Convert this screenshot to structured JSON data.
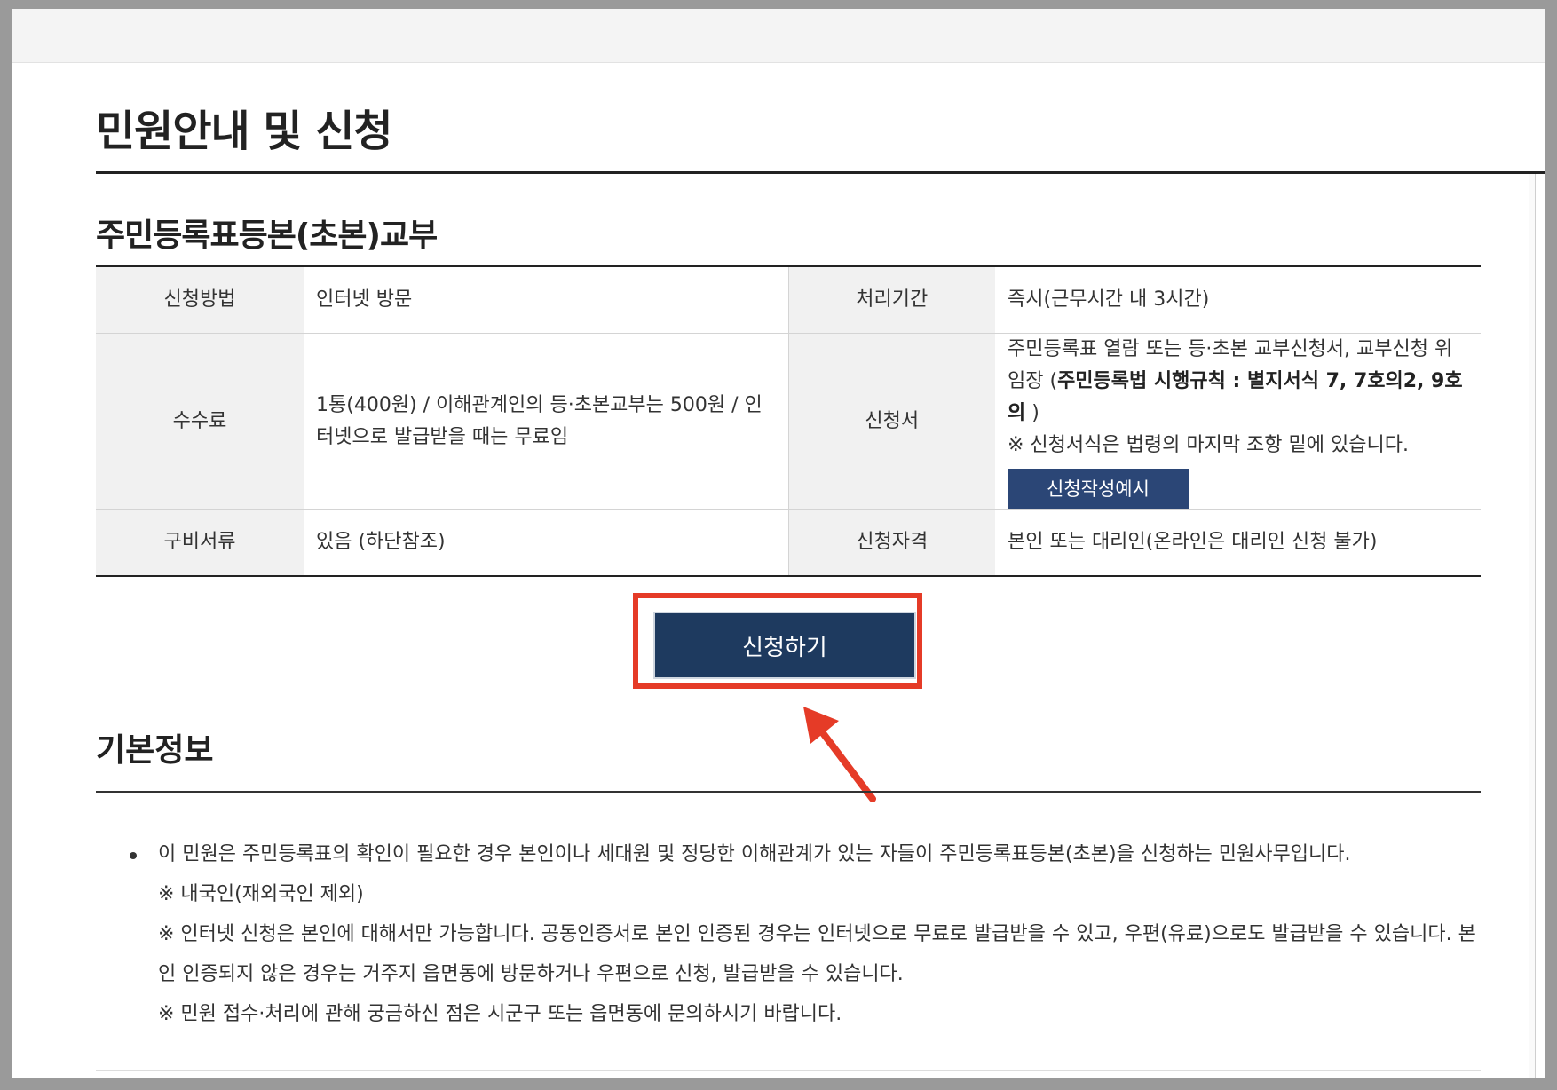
{
  "page": {
    "title": "민원안내 및 신청",
    "section_title": "주민등록표등본(초본)교부"
  },
  "info_table": {
    "method_label": "신청방법",
    "method_value": "인터넷 방문",
    "period_label": "처리기간",
    "period_value": "즉시(근무시간 내 3시간)",
    "fee_label": "수수료",
    "fee_value": "1통(400원) / 이해관계인의 등·초본교부는 500원 / 인터넷으로 발급받을 때는 무료임",
    "form_label": "신청서",
    "form_value_a": "주민등록표 열람 또는 등·초본 교부신청서, 교부신청 위임장 (",
    "form_value_bold": "주민등록법 시행규칙 : 별지서식 7, 7호의2, 9호의",
    "form_value_c": " )",
    "form_note": "※ 신청서식은 법령의 마지막 조항 밑에 있습니다.",
    "form_example_button": "신청작성예시",
    "docs_label": "구비서류",
    "docs_value": "있음 (하단참조)",
    "qualification_label": "신청자격",
    "qualification_value": "본인 또는 대리인(온라인은 대리인 신청 불가)"
  },
  "apply_button": "신청하기",
  "basic_info": {
    "title": "기본정보",
    "main_text": "이 민원은 주민등록표의 확인이 필요한 경우 본인이나 세대원 및 정당한 이해관계가 있는 자들이 주민등록표등본(초본)을 신청하는 민원사무입니다.",
    "note1": "※ 내국인(재외국인 제외)",
    "note2": "※ 인터넷 신청은 본인에 대해서만 가능합니다. 공동인증서로 본인 인증된 경우는 인터넷으로 무료로 발급받을 수 있고, 우편(유료)으로도 발급받을 수 있습니다. 본인 인증되지 않은 경우는 거주지 읍면동에 방문하거나 우편으로 신청, 발급받을 수 있습니다.",
    "note3": "※ 민원 접수·처리에 관해 궁금하신 점은 시군구 또는 읍면동에 문의하시기 바랍니다."
  },
  "colors": {
    "button_navy": "#1e3a5f",
    "inline_button": "#2b4676",
    "annotation_red": "#e53b27"
  }
}
